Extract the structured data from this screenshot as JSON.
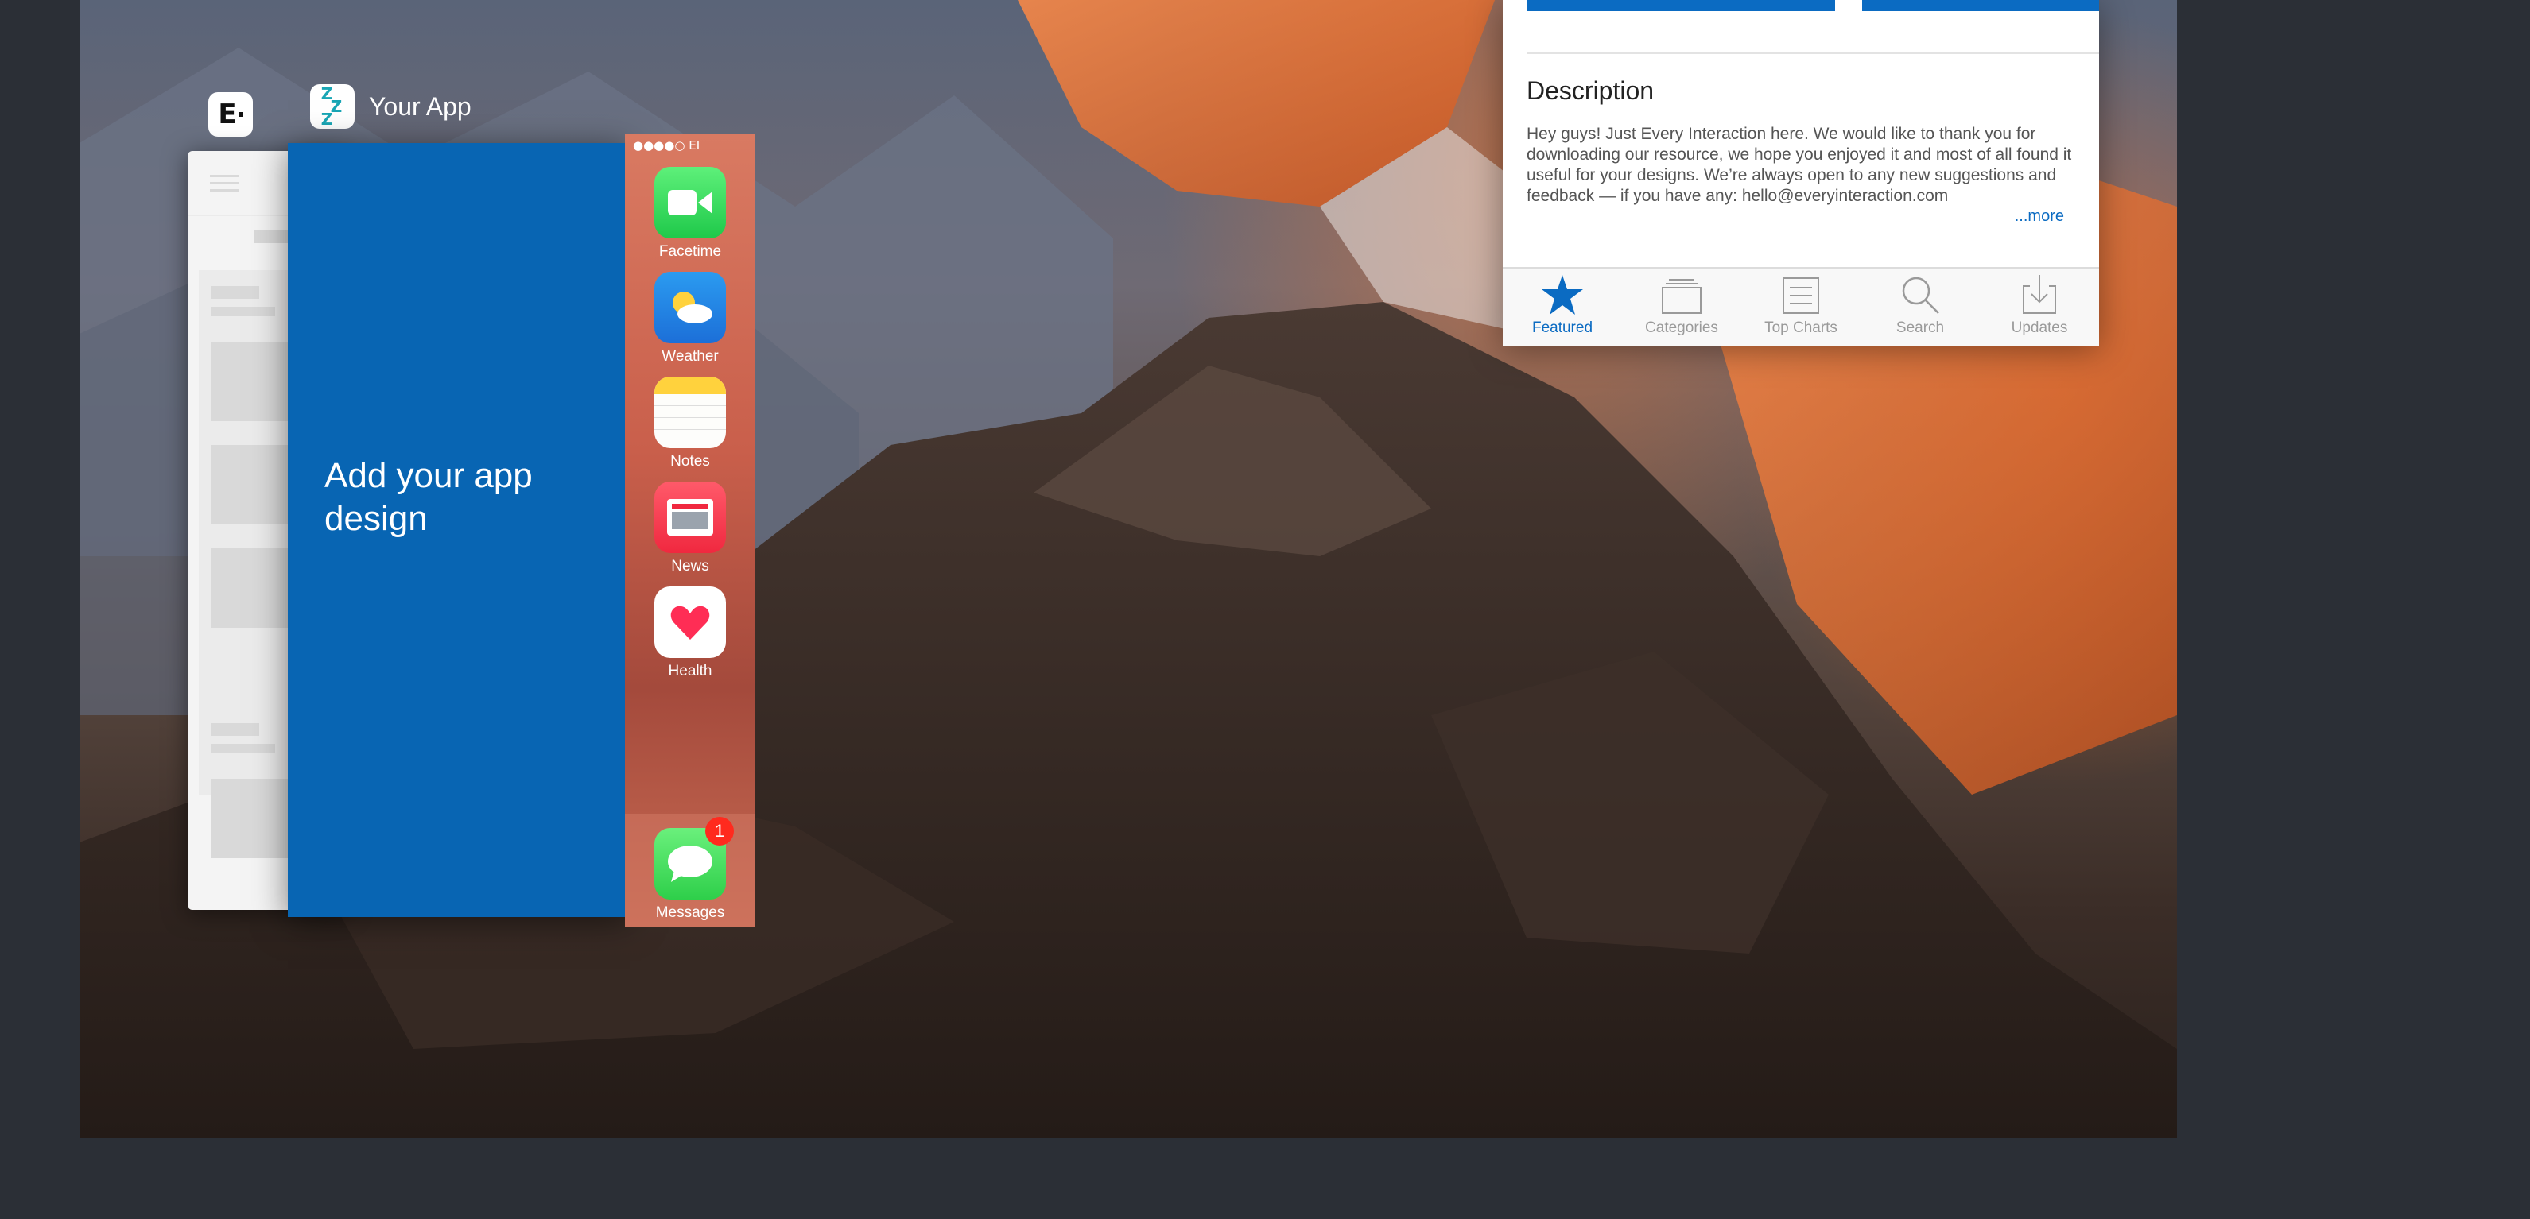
{
  "switcher": {
    "front_app_title": "Your App",
    "back_app_icon": "everyinteraction-logo-icon",
    "front_app_icon": "sleep-zzz-icon"
  },
  "blue_card": {
    "placeholder": "Add your app design",
    "color": "#0865b3"
  },
  "phone": {
    "status": "●●●●○ EI",
    "apps": [
      {
        "label": "Facetime",
        "icon": "facetime-icon"
      },
      {
        "label": "Weather",
        "icon": "weather-icon"
      },
      {
        "label": "Notes",
        "icon": "notes-icon"
      },
      {
        "label": "News",
        "icon": "news-icon"
      },
      {
        "label": "Health",
        "icon": "health-icon"
      }
    ],
    "dock": {
      "label": "Messages",
      "icon": "messages-icon",
      "badge": "1"
    }
  },
  "store": {
    "description_title": "Description",
    "description_body": "Hey guys! Just Every Interaction here. We would like to thank you for downloading our resource, we hope you enjoyed it and most of all found it useful for your designs. We’re always open to any new suggestions and feedback — if you have any: hello@everyinteraction.com",
    "more_link": "...more",
    "accent": "#0b6bc2",
    "tabs": [
      {
        "label": "Featured",
        "icon": "star-icon",
        "active": true
      },
      {
        "label": "Categories",
        "icon": "categories-icon",
        "active": false
      },
      {
        "label": "Top Charts",
        "icon": "list-icon",
        "active": false
      },
      {
        "label": "Search",
        "icon": "search-icon",
        "active": false
      },
      {
        "label": "Updates",
        "icon": "download-icon",
        "active": false
      }
    ]
  }
}
